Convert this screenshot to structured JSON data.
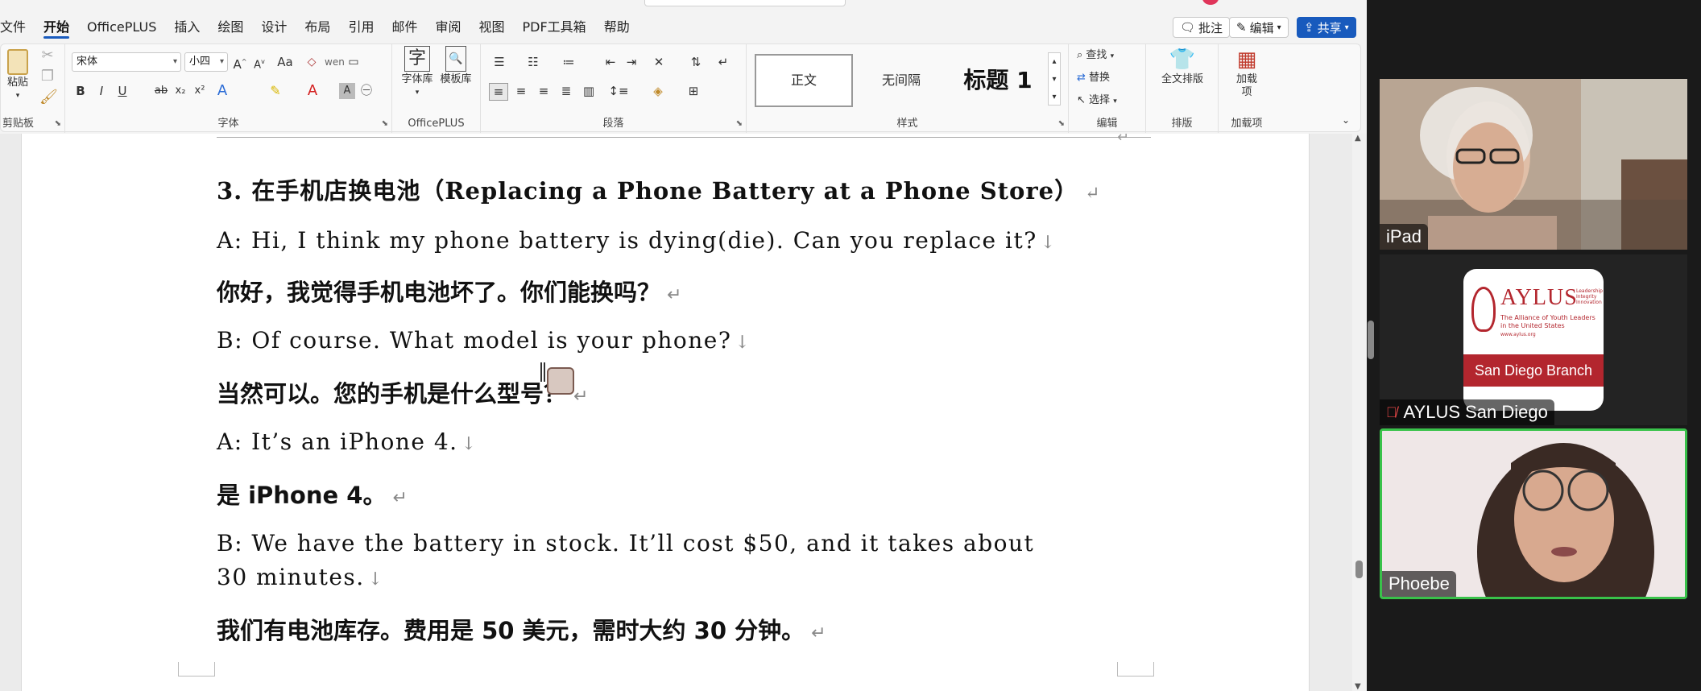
{
  "menu": [
    "文件",
    "开始",
    "OfficePLUS",
    "插入",
    "绘图",
    "设计",
    "布局",
    "引用",
    "邮件",
    "审阅",
    "视图",
    "PDF工具箱",
    "帮助"
  ],
  "menu_active": "开始",
  "top_buttons": {
    "comment": "批注",
    "edit": "编辑",
    "share": "共享"
  },
  "ribbon": {
    "clipboard": {
      "label": "剪贴板",
      "paste": "粘贴"
    },
    "font": {
      "label": "字体",
      "font_name": "宋体",
      "font_size": "小四"
    },
    "officeplus": {
      "label": "OfficePLUS",
      "btn1": "字体库",
      "btn2": "模板库"
    },
    "paragraph": {
      "label": "段落"
    },
    "styles": {
      "label": "样式",
      "items": [
        "正文",
        "无间隔",
        "标题 1"
      ]
    },
    "editing": {
      "label": "编辑",
      "find": "查找",
      "replace": "替换",
      "select": "选择"
    },
    "layout": {
      "label": "排版",
      "btn": "全文排版"
    },
    "addins": {
      "label": "加载项",
      "btn": "加载项"
    }
  },
  "document": {
    "heading": "3. 在手机店换电池（Replacing a Phone Battery at a Phone Store）",
    "lines": [
      {
        "type": "en",
        "text": "A: Hi, I think my phone battery is dying(die). Can you replace it?",
        "end": "↓"
      },
      {
        "type": "zh",
        "text": "你好，我觉得手机电池坏了。你们能换吗？",
        "end": "↵"
      },
      {
        "type": "en",
        "text": "B: Of course. What model is your phone?",
        "end": "↓"
      },
      {
        "type": "zh",
        "text": "当然可以。您的手机是什么型号？",
        "end": "↵"
      },
      {
        "type": "en",
        "text": "A: It’s an iPhone 4.",
        "end": "↓"
      },
      {
        "type": "zh",
        "text": "是 iPhone 4。",
        "end": "↵"
      },
      {
        "type": "en",
        "text": "B: We have the battery in stock. It’ll cost $50, and it takes about",
        "end": ""
      },
      {
        "type": "en",
        "text": "30 minutes.",
        "end": "↓"
      },
      {
        "type": "zh",
        "text": "我们有电池库存。费用是 50 美元，需时大约 30 分钟。",
        "end": "↵"
      }
    ]
  },
  "participants": [
    {
      "name": "iPad",
      "muted": false,
      "active": false
    },
    {
      "name": "AYLUS San Diego",
      "muted": true,
      "active": false,
      "logo": {
        "title": "AYLUS",
        "tagline1": "Leadership",
        "tagline2": "Integrity",
        "tagline3": "Innovation",
        "org_line1": "The Alliance of Youth Leaders",
        "org_line2": "in the United States",
        "url": "www.aylus.org",
        "branch": "San Diego Branch"
      }
    },
    {
      "name": "Phoebe",
      "muted": false,
      "active": true
    }
  ],
  "colors": {
    "accent": "#185abd",
    "active_speaker": "#39c24a",
    "aylus_red": "#b3262e",
    "gallery_bg": "#1a1a1a"
  }
}
